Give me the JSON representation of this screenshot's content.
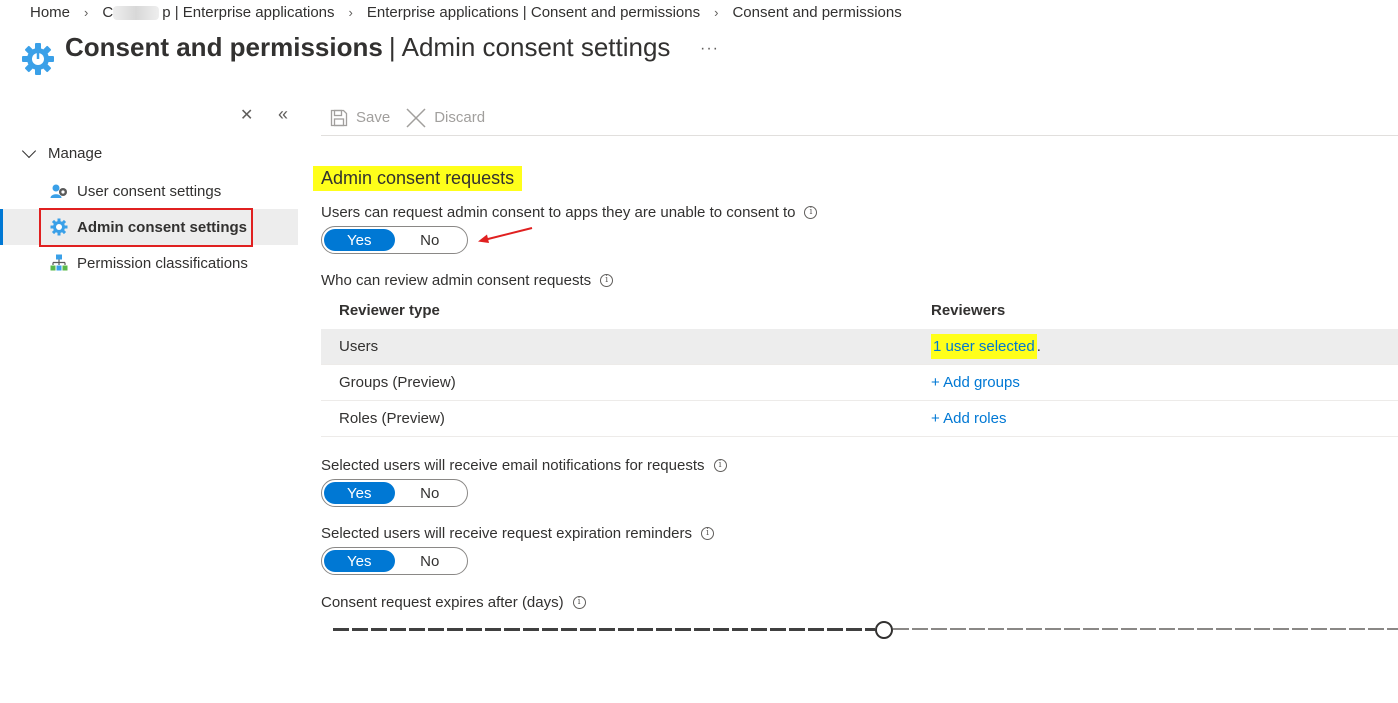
{
  "breadcrumb": {
    "items": [
      "Home",
      "C",
      "p | Enterprise applications",
      "Enterprise applications | Consent and permissions",
      "Consent and permissions"
    ]
  },
  "page": {
    "title_main": "Consent and permissions",
    "title_separator": "|",
    "title_sub": "Admin consent settings",
    "more": "···",
    "icon": "gear-icon"
  },
  "sidebar": {
    "close_glyph": "✕",
    "collapse_glyph": "«",
    "group_label": "Manage",
    "items": [
      {
        "label": "User consent settings",
        "icon": "user-gear-icon"
      },
      {
        "label": "Admin consent settings",
        "icon": "gear-icon",
        "active": true
      },
      {
        "label": "Permission classifications",
        "icon": "hierarchy-icon"
      }
    ]
  },
  "toolbar": {
    "save_label": "Save",
    "discard_label": "Discard"
  },
  "content": {
    "section_title": "Admin consent requests",
    "request_consent_label": "Users can request admin consent to apps they are unable to consent to",
    "yes_label": "Yes",
    "no_label": "No",
    "request_consent_value": "Yes",
    "reviewers_label": "Who can review admin consent requests",
    "table": {
      "headers": [
        "Reviewer type",
        "Reviewers"
      ],
      "rows": [
        {
          "type": "Users",
          "reviewers": "1 user selected",
          "suffix": "."
        },
        {
          "type": "Groups (Preview)",
          "reviewers": "+ Add groups"
        },
        {
          "type": "Roles (Preview)",
          "reviewers": "+ Add roles"
        }
      ]
    },
    "email_notifications_label": "Selected users will receive email notifications for requests",
    "email_notifications_value": "Yes",
    "expiration_reminders_label": "Selected users will receive request expiration reminders",
    "expiration_reminders_value": "Yes",
    "expires_label": "Consent request expires after (days)",
    "expires_slider_fraction": 0.517
  },
  "colors": {
    "accent": "#0078d4",
    "highlight": "#ffff1a",
    "annotation_red": "#e02020"
  }
}
